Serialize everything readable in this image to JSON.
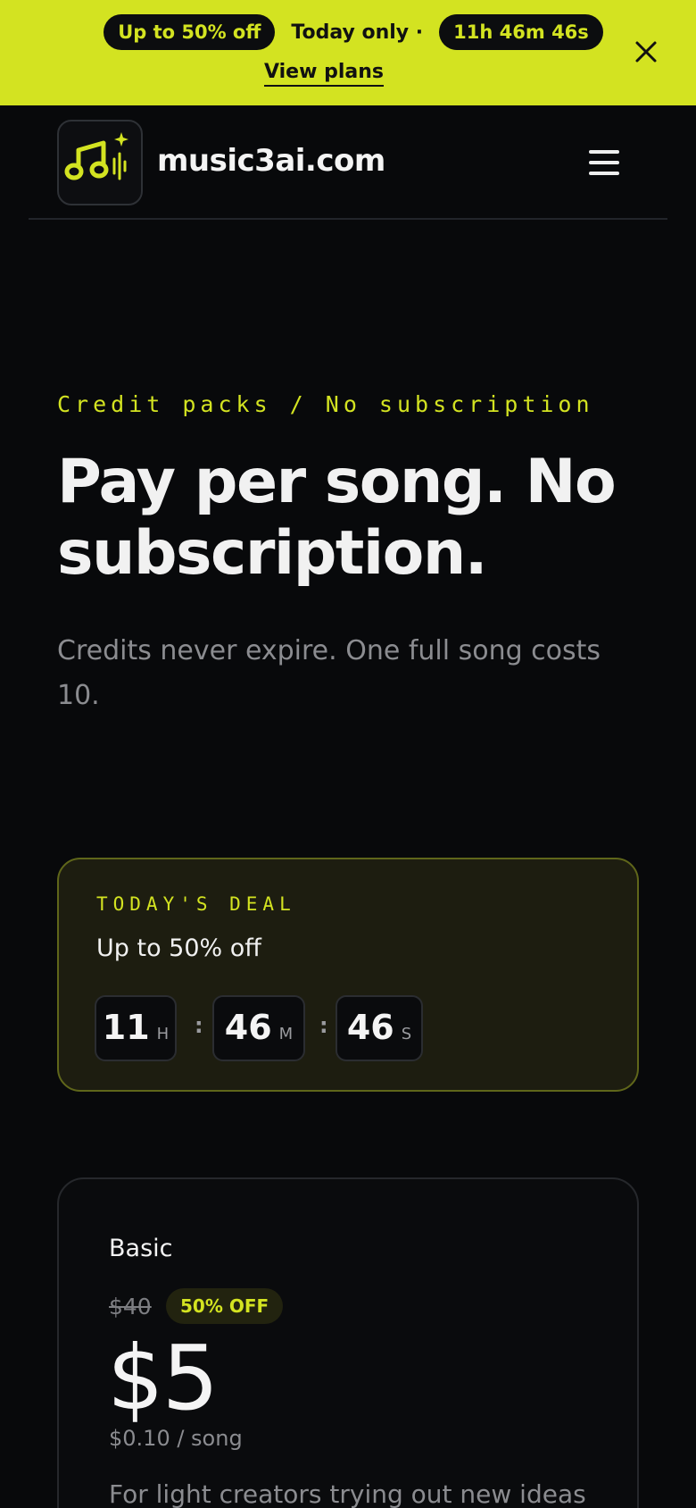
{
  "promo": {
    "discount_label": "Up to 50% off",
    "today_label": "Today only ·",
    "countdown_label": "11h 46m 46s",
    "cta_label": "View plans"
  },
  "header": {
    "brand": "music3ai.com"
  },
  "hero": {
    "eyebrow": "Credit packs / No subscription",
    "title": "Pay per song. No subscription.",
    "subtitle": "Credits never expire. One full song costs 10."
  },
  "deal": {
    "eyebrow": "TODAY'S DEAL",
    "title": "Up to 50% off",
    "timer": [
      {
        "value": "11",
        "unit": "H"
      },
      {
        "value": "46",
        "unit": "M"
      },
      {
        "value": "46",
        "unit": "S"
      }
    ],
    "separator": ":"
  },
  "plan": {
    "name": "Basic",
    "old_price": "$40",
    "badge": "50% OFF",
    "price": "$5",
    "per_song": "$0.10 / song",
    "description": "For light creators trying out new ideas"
  },
  "colors": {
    "accent": "#d3e321",
    "background": "#08090b"
  }
}
